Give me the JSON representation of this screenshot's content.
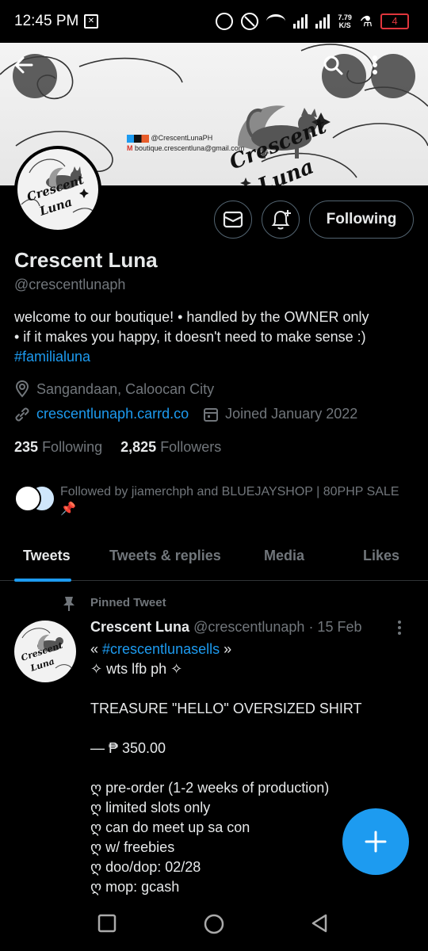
{
  "status_bar": {
    "time": "12:45 PM",
    "sim_icon": "sim-card-icon",
    "network_speed_top": "7.79",
    "network_speed_bottom": "K/S",
    "battery_level": "4",
    "battery_color": "#e0363d"
  },
  "banner": {
    "social_handle": "@CrescentLunaPH",
    "email": "boutique.crescentluna@gmail.com",
    "logo_text_1": "Crescent",
    "logo_text_2": "Luna"
  },
  "header_buttons": {
    "back_icon": "arrow-left-icon",
    "search_icon": "search-icon",
    "more_icon": "more-vertical-icon"
  },
  "profile": {
    "name": "Crescent Luna",
    "handle": "@crescentlunaph",
    "bio_line1": "welcome to our boutique! • handled by the OWNER only",
    "bio_line2": "• if it makes you happy, it doesn't need to make sense :)",
    "bio_hashtag": "#familialuna",
    "location": "Sangandaan, Caloocan City",
    "website": "crescentlunaph.carrd.co",
    "joined": "Joined January 2022",
    "following_count": "235",
    "following_label": "Following",
    "followers_count": "2,825",
    "followers_label": "Followers",
    "followed_by": "Followed by jiamerchph and BLUEJAYSHOP | 80PHP SALE",
    "followed_by_emoji": "📌"
  },
  "actions": {
    "message_icon": "mail-icon",
    "notify_icon": "bell-plus-icon",
    "follow_label": "Following"
  },
  "tabs": [
    {
      "label": "Tweets",
      "active": true
    },
    {
      "label": "Tweets & replies",
      "active": false
    },
    {
      "label": "Media",
      "active": false
    },
    {
      "label": "Likes",
      "active": false
    }
  ],
  "pinned_tweet": {
    "pinned_label": "Pinned Tweet",
    "author_name": "Crescent Luna",
    "author_handle": "@crescentlunaph",
    "date": "· 15 Feb",
    "hashtag_line_prefix": "« ",
    "hashtag": "#crescentlunasells",
    "hashtag_line_suffix": " »",
    "lines": [
      "✧ wts lfb ph ✧",
      "",
      "TREASURE \"HELLO\" OVERSIZED SHIRT",
      "",
      "— ₱ 350.00",
      "",
      "ღ pre-order (1-2 weeks of production)",
      "ღ limited slots only",
      "ღ can do meet up sa con",
      "ღ w/ freebies",
      "ღ doo/dop: 02/28",
      "ღ mop: gcash"
    ]
  },
  "fab": {
    "label": "+",
    "icon": "compose-plus-icon",
    "color": "#1d9bf0"
  },
  "nav": {
    "recent_icon": "square-icon",
    "home_icon": "circle-icon",
    "back_icon": "triangle-back-icon"
  },
  "colors": {
    "accent": "#1d9bf0",
    "background": "#000000",
    "muted": "#71767b"
  }
}
